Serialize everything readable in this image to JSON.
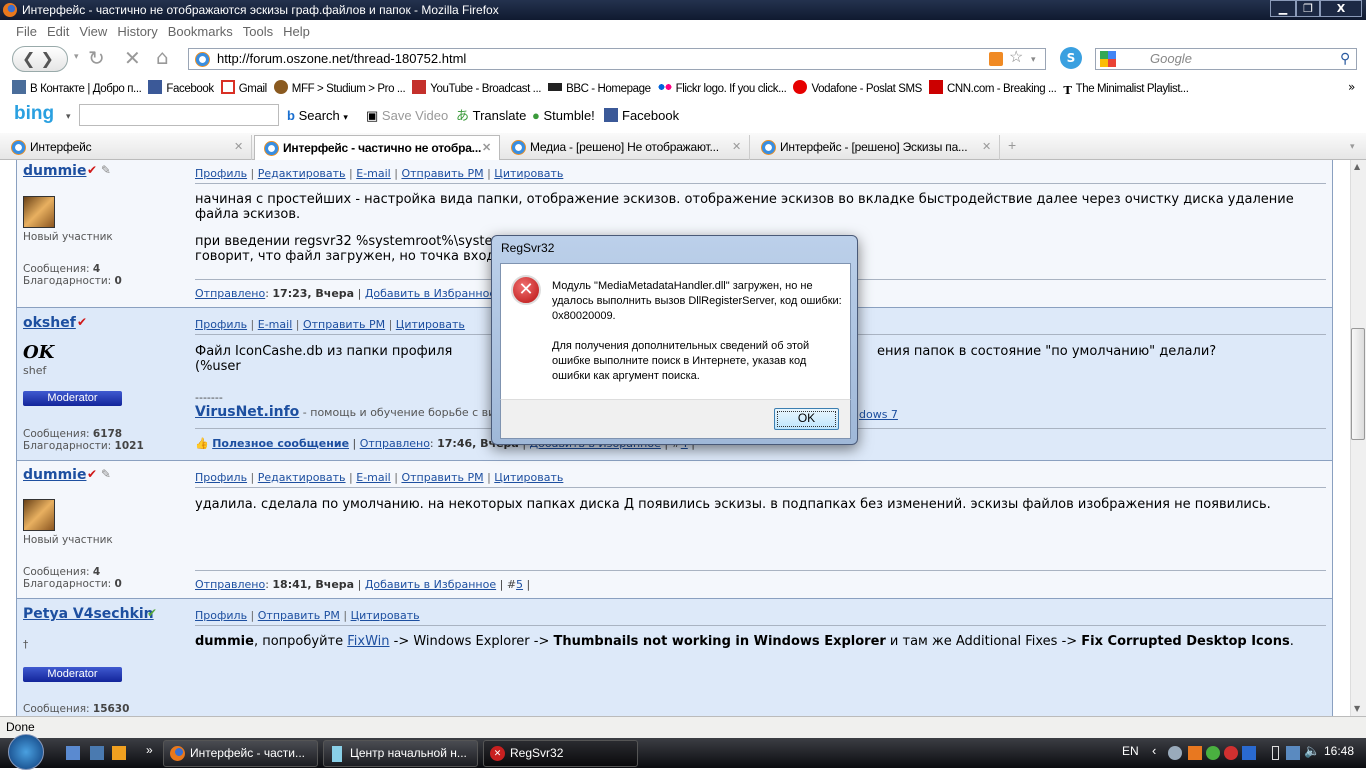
{
  "window": {
    "title": "Интерфейс - частично не отображаются эскизы граф.файлов и папок - Mozilla Firefox",
    "min": "▁",
    "max": "❐",
    "close": "X"
  },
  "menu": [
    "File",
    "Edit",
    "View",
    "History",
    "Bookmarks",
    "Tools",
    "Help"
  ],
  "nav": {
    "url": "http://forum.oszone.net/thread-180752.html",
    "search_placeholder": "Google"
  },
  "bookmarks": [
    {
      "label": "В Контакте | Добро п...",
      "icon": "vk-icon",
      "color": "#4a6d9a"
    },
    {
      "label": "Facebook",
      "icon": "facebook-icon",
      "color": "#3b5998"
    },
    {
      "label": "Gmail",
      "icon": "gmail-icon",
      "color": "#d93025"
    },
    {
      "label": "MFF > Studium > Pro ...",
      "icon": "mff-icon",
      "color": "#8a5a20"
    },
    {
      "label": "YouTube - Broadcast ...",
      "icon": "youtube-icon",
      "color": "#c4302b"
    },
    {
      "label": "BBC - Homepage",
      "icon": "bbc-icon",
      "color": "#222222"
    },
    {
      "label": "Flickr logo. If you click...",
      "icon": "flickr-icon",
      "color": "#ff0084"
    },
    {
      "label": "Vodafone - Poslat SMS",
      "icon": "vodafone-icon",
      "color": "#e60000"
    },
    {
      "label": "CNN.com - Breaking ...",
      "icon": "cnn-icon",
      "color": "#cc0000"
    },
    {
      "label": "The Minimalist Playlist...",
      "icon": "nyt-icon",
      "color": "#000000"
    }
  ],
  "bookmarks_more": "»",
  "bing": {
    "logo": "bing",
    "search": "Search",
    "save_video": "Save Video",
    "translate": "Translate",
    "stumble": "Stumble!",
    "facebook": "Facebook"
  },
  "tabs": [
    {
      "label": "Интерфейс",
      "active": false
    },
    {
      "label": "Интерфейс - частично не отобра...",
      "active": true
    },
    {
      "label": "Медиа - [решено] Не отображают...",
      "active": false
    },
    {
      "label": "Интерфейс - [решено] Эскизы па...",
      "active": false
    }
  ],
  "posts": [
    {
      "user": "dummie",
      "title": "Новый участник",
      "messages": "4",
      "thanks": "0",
      "links": [
        "Профиль",
        "Редактировать",
        "E-mail",
        "Отправить PM",
        "Цитировать"
      ],
      "text1": "начиная с простейших - настройка вида папки, отображение эскизов. отображение эскизов во вкладке быстродействие далее через очистку диска удаление файла эскизов.",
      "text2a": "при введении regsvr32 %systemroot%\\system",
      "text2b": "говорит, что файл загружен, но точка входа",
      "sent_label": "Отправлено",
      "sent": "17:23, Вчера",
      "fav": "Добавить в Избранное"
    },
    {
      "user": "okshef",
      "sig": "OK",
      "title": "shef",
      "badge": "Moderator",
      "messages": "6178",
      "thanks": "1021",
      "links": [
        "Профиль",
        "E-mail",
        "Отправить PM",
        "Цитировать"
      ],
      "text_a": "Файл IconCashe.db из папки профиля (%user",
      "text_b": "ения папок в состояние \"по умолчанию\" делали?",
      "sig_sep": "-------",
      "sig_link": "VirusNet.info",
      "sig_text": " - помощь и обучение борьбе с вир",
      "sig_tail": "dows 7",
      "useful": "Полезное сообщение",
      "sent_label": "Отправлено",
      "sent": "17:46, Вчера",
      "fav": "Добавить в Избранное",
      "num": "4"
    },
    {
      "user": "dummie",
      "title": "Новый участник",
      "messages": "4",
      "thanks": "0",
      "links": [
        "Профиль",
        "Редактировать",
        "E-mail",
        "Отправить PM",
        "Цитировать"
      ],
      "text": "удалила. сделала по умолчанию. на некоторых папках диска Д появились эскизы. в подпапках без изменений. эскизы файлов изображения не появились.",
      "sent_label": "Отправлено",
      "sent": "18:41, Вчера",
      "fav": "Добавить в Избранное",
      "num": "5"
    },
    {
      "user": "Petya V4sechkin",
      "title": "†",
      "badge": "Moderator",
      "messages": "15630",
      "links": [
        "Профиль",
        "Отправить PM",
        "Цитировать"
      ],
      "t1": "dummie",
      "t2": ", попробуйте ",
      "t3": "FixWin",
      "t4": " -> Windows Explorer -> ",
      "t5": "Thumbnails not working in Windows Explorer",
      "t6": " и там же Additional Fixes -> ",
      "t7": "Fix Corrupted Desktop Icons",
      "t8": "."
    }
  ],
  "labels": {
    "messages": "Сообщения: ",
    "thanks": "Благодарности: "
  },
  "status": "Done",
  "dialog": {
    "title": "RegSvr32",
    "msg1": "Модуль \"MediaMetadataHandler.dll\" загружен, но не удалось выполнить вызов DllRegisterServer, код ошибки: 0x80020009.",
    "msg2": "Для получения дополнительных сведений об этой ошибке выполните поиск в Интернете, указав код ошибки как аргумент поиска.",
    "ok": "OK"
  },
  "taskbar": {
    "items": [
      "Интерфейс - части...",
      "Центр начальной н...",
      "RegSvr32"
    ],
    "lang": "EN",
    "clock": "16:48",
    "more": "»"
  }
}
